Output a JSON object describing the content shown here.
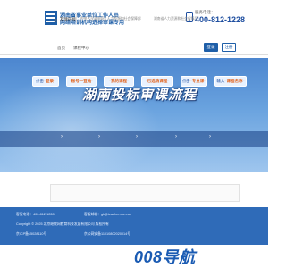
{
  "header": {
    "title_line1": "湖南省事业单位工作人员",
    "title_line2": "网络培训机构选择审课专用",
    "phone_label": "服务电话：",
    "phone_number": "400-812-1228"
  },
  "nav": {
    "items": [
      "首页",
      "课程中心"
    ],
    "login_label": "登录",
    "register_label": "注册"
  },
  "banner": {
    "title": "湖南投标审课流程",
    "steps": [
      {
        "prefix": "点击",
        "highlight": "\"登录\""
      },
      {
        "prefix": "",
        "highlight": "\"账号一登陆\""
      },
      {
        "prefix": "",
        "highlight": "\"我的课程\""
      },
      {
        "prefix": "",
        "highlight": "\"已选购课程\""
      },
      {
        "prefix": "点击",
        "highlight": "\"专业课\""
      },
      {
        "prefix": "输入",
        "highlight": "\"课程名称\""
      }
    ]
  },
  "links": {
    "label": "友情链接",
    "items": [
      "中央人民政府网 | 人力资源和社会保障部",
      "湖南省人力资源和社会保障厅"
    ]
  },
  "footer": {
    "row1_left": "客服电话：400-812-1228",
    "row1_mid": "客服邮箱：gk@teacher.com.cn",
    "row2": "Copyright © 2025  北京继教网教育科技发展有限公司 版权所有",
    "row3_left": "京ICP备15028110号",
    "row3_mid": "京公网安备11010802020014号"
  },
  "watermark": {
    "text": "008导航"
  },
  "colors": {
    "brand_blue": "#1f5fa8",
    "footer_blue": "#2f6bb8",
    "highlight_orange": "#e2621b"
  }
}
